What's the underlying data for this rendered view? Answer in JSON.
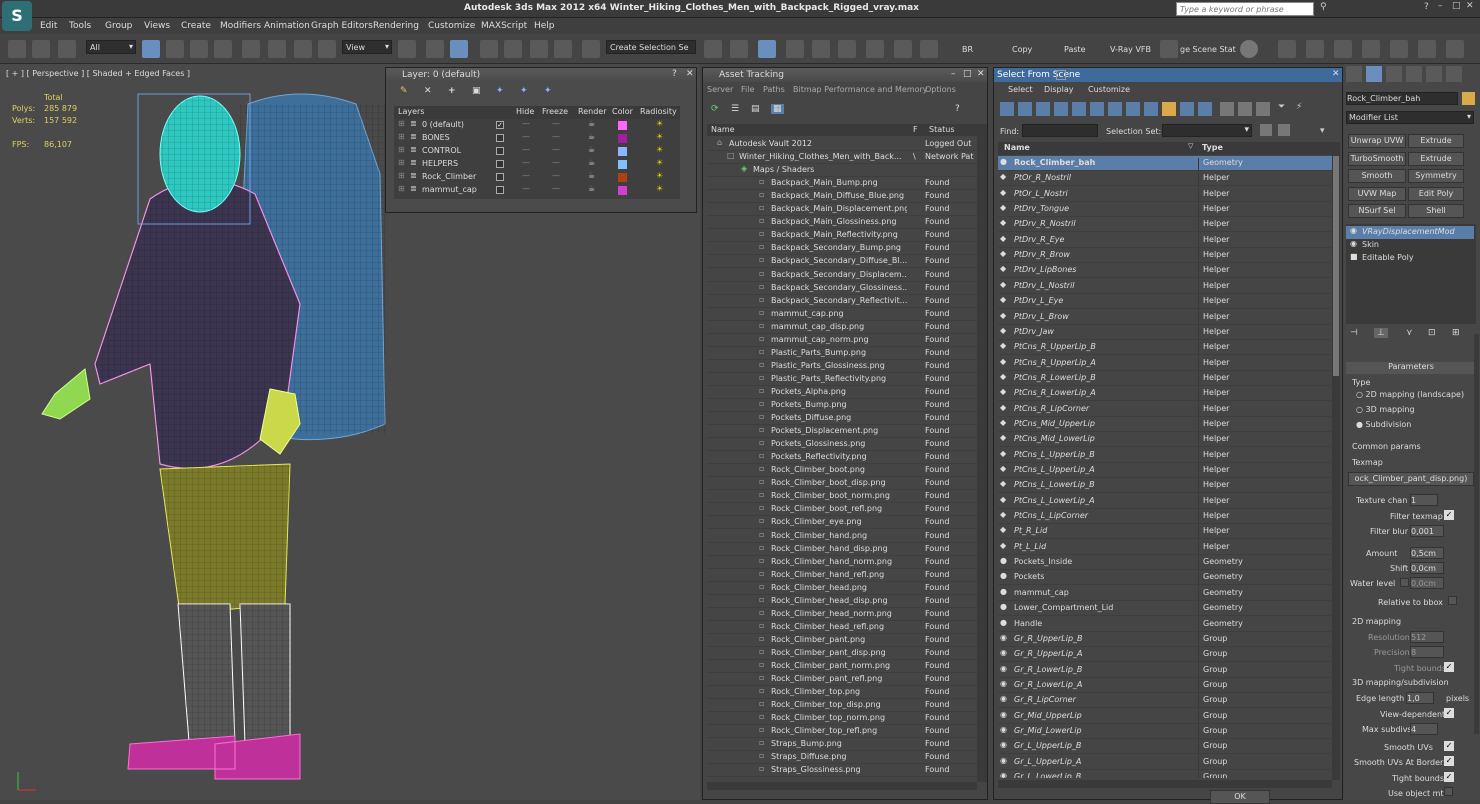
{
  "app": {
    "title": "Autodesk 3ds Max  2012 x64     Winter_Hiking_Clothes_Men_with_Backpack_Rigged_vray.max",
    "search_placeholder": "Type a keyword or phrase"
  },
  "menu": [
    "Edit",
    "Tools",
    "Group",
    "Views",
    "Create",
    "Modifiers",
    "Animation",
    "Graph Editors",
    "Rendering",
    "Customize",
    "MAXScript",
    "Help"
  ],
  "toolbar": {
    "filter": "All",
    "refcoord": "View",
    "selection_set": "Create Selection Se",
    "br": "BR",
    "copy": "Copy",
    "paste": "Paste",
    "vrayvfb": "V-Ray VFB",
    "scene_stat": "ge Scene Stat"
  },
  "viewport": {
    "label": "[ + ] [ Perspective ] [ Shaded + Edged Faces ]",
    "stats": {
      "total_label": "Total",
      "polys_label": "Polys:",
      "polys": "285 879",
      "verts_label": "Verts:",
      "verts": "157 592",
      "fps_label": "FPS:",
      "fps": "86,107"
    }
  },
  "layers": {
    "title": "Layer: 0 (default)",
    "columns": [
      "Layers",
      "Hide",
      "Freeze",
      "Render",
      "Color",
      "Radiosity"
    ],
    "items": [
      {
        "name": "0 (default)",
        "color": "#ff66ff"
      },
      {
        "name": "BONES",
        "color": "#a020a0"
      },
      {
        "name": "CONTROL",
        "color": "#8cb4ff"
      },
      {
        "name": "HELPERS",
        "color": "#80c0ff"
      },
      {
        "name": "Rock_Climber",
        "color": "#b04010"
      },
      {
        "name": "mammut_cap",
        "color": "#d040d0"
      }
    ]
  },
  "asset": {
    "title": "Asset Tracking",
    "menu": [
      "Server",
      "File",
      "Paths",
      "Bitmap Performance and Memory",
      "Options"
    ],
    "columns": [
      "Name",
      "F",
      "Status"
    ],
    "items": [
      {
        "n": "Autodesk Vault 2012",
        "s": "Logged Out",
        "lvl": 1
      },
      {
        "n": "Winter_Hiking_Clothes_Men_with_Back...",
        "f": "\\",
        "s": "Network Pat",
        "lvl": 2
      },
      {
        "n": "Maps / Shaders",
        "s": "",
        "lvl": 3
      },
      {
        "n": "Backpack_Main_Bump.png",
        "s": "Found",
        "lvl": 4
      },
      {
        "n": "Backpack_Main_Diffuse_Blue.png",
        "s": "Found",
        "lvl": 4
      },
      {
        "n": "Backpack_Main_Displacement.png",
        "s": "Found",
        "lvl": 4
      },
      {
        "n": "Backpack_Main_Glossiness.png",
        "s": "Found",
        "lvl": 4
      },
      {
        "n": "Backpack_Main_Reflectivity.png",
        "s": "Found",
        "lvl": 4
      },
      {
        "n": "Backpack_Secondary_Bump.png",
        "s": "Found",
        "lvl": 4
      },
      {
        "n": "Backpack_Secondary_Diffuse_Bl...",
        "s": "Found",
        "lvl": 4
      },
      {
        "n": "Backpack_Secondary_Displacem...",
        "s": "Found",
        "lvl": 4
      },
      {
        "n": "Backpack_Secondary_Glossiness...",
        "s": "Found",
        "lvl": 4
      },
      {
        "n": "Backpack_Secondary_Reflectivit...",
        "s": "Found",
        "lvl": 4
      },
      {
        "n": "mammut_cap.png",
        "s": "Found",
        "lvl": 4
      },
      {
        "n": "mammut_cap_disp.png",
        "s": "Found",
        "lvl": 4
      },
      {
        "n": "mammut_cap_norm.png",
        "s": "Found",
        "lvl": 4
      },
      {
        "n": "Plastic_Parts_Bump.png",
        "s": "Found",
        "lvl": 4
      },
      {
        "n": "Plastic_Parts_Glossiness.png",
        "s": "Found",
        "lvl": 4
      },
      {
        "n": "Plastic_Parts_Reflectivity.png",
        "s": "Found",
        "lvl": 4
      },
      {
        "n": "Pockets_Alpha.png",
        "s": "Found",
        "lvl": 4
      },
      {
        "n": "Pockets_Bump.png",
        "s": "Found",
        "lvl": 4
      },
      {
        "n": "Pockets_Diffuse.png",
        "s": "Found",
        "lvl": 4
      },
      {
        "n": "Pockets_Displacement.png",
        "s": "Found",
        "lvl": 4
      },
      {
        "n": "Pockets_Glossiness.png",
        "s": "Found",
        "lvl": 4
      },
      {
        "n": "Pockets_Reflectivity.png",
        "s": "Found",
        "lvl": 4
      },
      {
        "n": "Rock_Climber_boot.png",
        "s": "Found",
        "lvl": 4
      },
      {
        "n": "Rock_Climber_boot_disp.png",
        "s": "Found",
        "lvl": 4
      },
      {
        "n": "Rock_Climber_boot_norm.png",
        "s": "Found",
        "lvl": 4
      },
      {
        "n": "Rock_Climber_boot_refl.png",
        "s": "Found",
        "lvl": 4
      },
      {
        "n": "Rock_Climber_eye.png",
        "s": "Found",
        "lvl": 4
      },
      {
        "n": "Rock_Climber_hand.png",
        "s": "Found",
        "lvl": 4
      },
      {
        "n": "Rock_Climber_hand_disp.png",
        "s": "Found",
        "lvl": 4
      },
      {
        "n": "Rock_Climber_hand_norm.png",
        "s": "Found",
        "lvl": 4
      },
      {
        "n": "Rock_Climber_hand_refl.png",
        "s": "Found",
        "lvl": 4
      },
      {
        "n": "Rock_Climber_head.png",
        "s": "Found",
        "lvl": 4
      },
      {
        "n": "Rock_Climber_head_disp.png",
        "s": "Found",
        "lvl": 4
      },
      {
        "n": "Rock_Climber_head_norm.png",
        "s": "Found",
        "lvl": 4
      },
      {
        "n": "Rock_Climber_head_refl.png",
        "s": "Found",
        "lvl": 4
      },
      {
        "n": "Rock_Climber_pant.png",
        "s": "Found",
        "lvl": 4
      },
      {
        "n": "Rock_Climber_pant_disp.png",
        "s": "Found",
        "lvl": 4
      },
      {
        "n": "Rock_Climber_pant_norm.png",
        "s": "Found",
        "lvl": 4
      },
      {
        "n": "Rock_Climber_pant_refl.png",
        "s": "Found",
        "lvl": 4
      },
      {
        "n": "Rock_Climber_top.png",
        "s": "Found",
        "lvl": 4
      },
      {
        "n": "Rock_Climber_top_disp.png",
        "s": "Found",
        "lvl": 4
      },
      {
        "n": "Rock_Climber_top_norm.png",
        "s": "Found",
        "lvl": 4
      },
      {
        "n": "Rock_Climber_top_refl.png",
        "s": "Found",
        "lvl": 4
      },
      {
        "n": "Straps_Bump.png",
        "s": "Found",
        "lvl": 4
      },
      {
        "n": "Straps_Diffuse.png",
        "s": "Found",
        "lvl": 4
      },
      {
        "n": "Straps_Glossiness.png",
        "s": "Found",
        "lvl": 4
      }
    ]
  },
  "select": {
    "title": "Select From Scene",
    "menu": [
      "Select",
      "Display",
      "Customize"
    ],
    "find_label": "Find:",
    "selset_label": "Selection Set:",
    "columns": [
      "Name",
      "Type"
    ],
    "ok": "OK",
    "items": [
      {
        "n": "Rock_Climber_bah",
        "t": "Geometry",
        "k": "geo",
        "sel": true
      },
      {
        "n": "PtOr_R_Nostril",
        "t": "Helper",
        "k": "h"
      },
      {
        "n": "PtOr_L_Nostri",
        "t": "Helper",
        "k": "h"
      },
      {
        "n": "PtDrv_Tongue",
        "t": "Helper",
        "k": "h"
      },
      {
        "n": "PtDrv_R_Nostril",
        "t": "Helper",
        "k": "h"
      },
      {
        "n": "PtDrv_R_Eye",
        "t": "Helper",
        "k": "h"
      },
      {
        "n": "PtDrv_R_Brow",
        "t": "Helper",
        "k": "h"
      },
      {
        "n": "PtDrv_LipBones",
        "t": "Helper",
        "k": "h"
      },
      {
        "n": "PtDrv_L_Nostril",
        "t": "Helper",
        "k": "h"
      },
      {
        "n": "PtDrv_L_Eye",
        "t": "Helper",
        "k": "h"
      },
      {
        "n": "PtDrv_L_Brow",
        "t": "Helper",
        "k": "h"
      },
      {
        "n": "PtDrv_Jaw",
        "t": "Helper",
        "k": "h"
      },
      {
        "n": "PtCns_R_UpperLip_B",
        "t": "Helper",
        "k": "h"
      },
      {
        "n": "PtCns_R_UpperLip_A",
        "t": "Helper",
        "k": "h"
      },
      {
        "n": "PtCns_R_LowerLip_B",
        "t": "Helper",
        "k": "h"
      },
      {
        "n": "PtCns_R_LowerLip_A",
        "t": "Helper",
        "k": "h"
      },
      {
        "n": "PtCns_R_LipCorner",
        "t": "Helper",
        "k": "h"
      },
      {
        "n": "PtCns_Mid_UpperLip",
        "t": "Helper",
        "k": "h"
      },
      {
        "n": "PtCns_Mid_LowerLip",
        "t": "Helper",
        "k": "h"
      },
      {
        "n": "PtCns_L_UpperLip_B",
        "t": "Helper",
        "k": "h"
      },
      {
        "n": "PtCns_L_UpperLip_A",
        "t": "Helper",
        "k": "h"
      },
      {
        "n": "PtCns_L_LowerLip_B",
        "t": "Helper",
        "k": "h"
      },
      {
        "n": "PtCns_L_LowerLip_A",
        "t": "Helper",
        "k": "h"
      },
      {
        "n": "PtCns_L_LipCorner",
        "t": "Helper",
        "k": "h"
      },
      {
        "n": "Pt_R_Lid",
        "t": "Helper",
        "k": "h"
      },
      {
        "n": "Pt_L_Lid",
        "t": "Helper",
        "k": "h"
      },
      {
        "n": "Pockets_Inside",
        "t": "Geometry",
        "k": "geo"
      },
      {
        "n": "Pockets",
        "t": "Geometry",
        "k": "geo"
      },
      {
        "n": "mammut_cap",
        "t": "Geometry",
        "k": "geo"
      },
      {
        "n": "Lower_Compartment_Lid",
        "t": "Geometry",
        "k": "geo"
      },
      {
        "n": "Handle",
        "t": "Geometry",
        "k": "geo"
      },
      {
        "n": "Gr_R_UpperLip_B",
        "t": "Group",
        "k": "g"
      },
      {
        "n": "Gr_R_UpperLip_A",
        "t": "Group",
        "k": "g"
      },
      {
        "n": "Gr_R_LowerLip_B",
        "t": "Group",
        "k": "g"
      },
      {
        "n": "Gr_R_LowerLip_A",
        "t": "Group",
        "k": "g"
      },
      {
        "n": "Gr_R_LipCorner",
        "t": "Group",
        "k": "g"
      },
      {
        "n": "Gr_Mid_UpperLip",
        "t": "Group",
        "k": "g"
      },
      {
        "n": "Gr_Mid_LowerLip",
        "t": "Group",
        "k": "g"
      },
      {
        "n": "Gr_L_UpperLip_B",
        "t": "Group",
        "k": "g"
      },
      {
        "n": "Gr_L_UpperLip_A",
        "t": "Group",
        "k": "g"
      },
      {
        "n": "Gr_L_LowerLip_B",
        "t": "Group",
        "k": "g"
      }
    ]
  },
  "cmd": {
    "object_name": "Rock_Climber_bah",
    "modifier_list": "Modifier List",
    "buttons": [
      [
        "Unwrap UVW",
        "Extrude"
      ],
      [
        "TurboSmooth",
        "Extrude"
      ],
      [
        "Smooth",
        "Symmetry"
      ],
      [
        "UVW Map",
        "Edit Poly"
      ],
      [
        "NSurf Sel",
        "Shell"
      ]
    ],
    "stack": [
      "VRayDisplacementMod",
      "Skin",
      "Editable Poly"
    ],
    "params_title": "Parameters",
    "type_label": "Type",
    "radio": [
      "2D mapping (landscape)",
      "3D mapping",
      "Subdivision"
    ],
    "common": "Common params",
    "texmap_label": "Texmap",
    "texmap": "ock_Climber_pant_disp.png)",
    "texture_chan_label": "Texture chan",
    "texture_chan": "1",
    "filter_texmap": "Filter texmap",
    "filter_blur_label": "Filter blur",
    "filter_blur": "0,001",
    "amount_label": "Amount",
    "amount": "0,5cm",
    "shift_label": "Shift",
    "shift": "0,0cm",
    "water_label": "Water level",
    "water": "0,0cm",
    "rel_bbox": "Relative to bbox",
    "map2d": "2D mapping",
    "resolution_label": "Resolution",
    "resolution": "512",
    "precision_label": "Precision",
    "precision": "8",
    "tight_bounds": "Tight bounds",
    "map3d": "3D mapping/subdivision",
    "edge_length_label": "Edge length",
    "edge_length": "1,0",
    "pixels": "pixels",
    "view_dep": "View-dependent",
    "max_subdivs_label": "Max subdivs",
    "max_subdivs": "4",
    "smooth_uvs": "Smooth UVs",
    "smooth_uvs_borders": "Smooth UVs At Borders",
    "tight_bounds2": "Tight bounds",
    "use_object_mtl": "Use object mtl"
  }
}
